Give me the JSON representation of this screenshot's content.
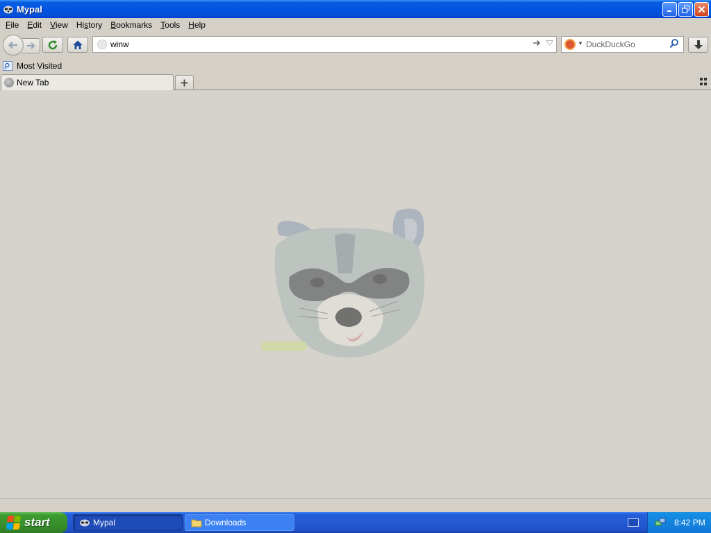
{
  "window": {
    "title": "Mypal"
  },
  "menu": [
    {
      "pre": "",
      "u": "F",
      "post": "ile"
    },
    {
      "pre": "",
      "u": "E",
      "post": "dit"
    },
    {
      "pre": "",
      "u": "V",
      "post": "iew"
    },
    {
      "pre": "Hi",
      "u": "s",
      "post": "tory"
    },
    {
      "pre": "",
      "u": "B",
      "post": "ookmarks"
    },
    {
      "pre": "",
      "u": "T",
      "post": "ools"
    },
    {
      "pre": "",
      "u": "H",
      "post": "elp"
    }
  ],
  "navbar": {
    "url_value": "winw",
    "search_placeholder": "DuckDuckGo"
  },
  "bookmarks": {
    "most_visited": "Most Visited"
  },
  "tabs": [
    {
      "label": "New Tab"
    }
  ],
  "taskbar": {
    "start_label": "start",
    "tasks": [
      {
        "label": "Mypal"
      },
      {
        "label": "Downloads"
      }
    ],
    "clock": "8:42 PM"
  },
  "colors": {
    "titlebar": "#0054e3",
    "taskbar": "#245edb",
    "start": "#388f2b",
    "content_bg": "#d6d3cd"
  }
}
